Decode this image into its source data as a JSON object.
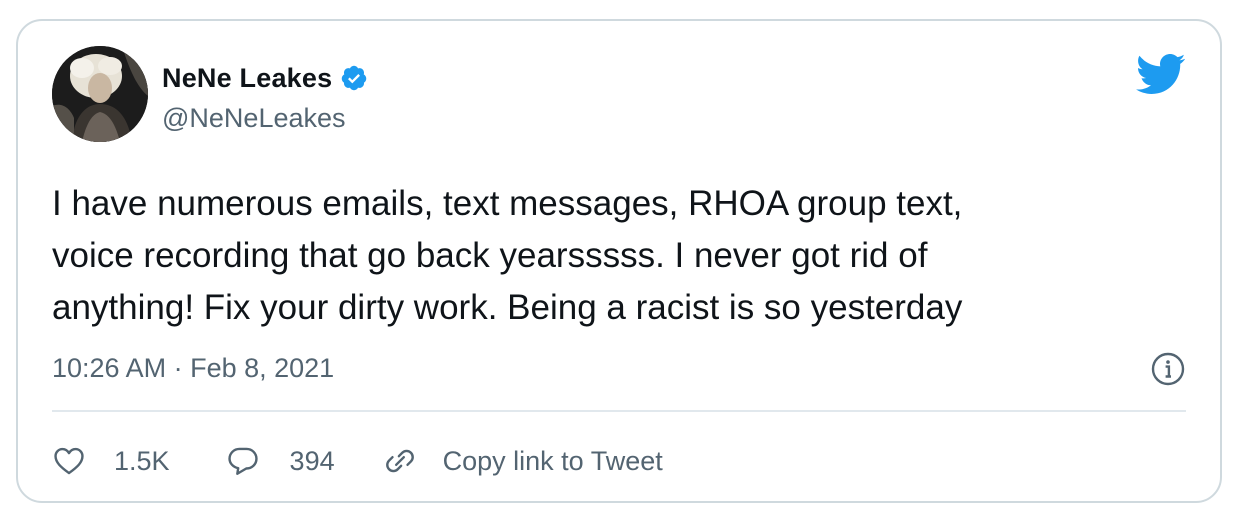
{
  "tweet": {
    "author": {
      "display_name": "NeNe Leakes",
      "handle": "@NeNeLeakes",
      "verified": true,
      "avatar": "profile-photo"
    },
    "text": "I have numerous emails, text messages, RHOA group text,\nvoice recording that go back yearsssss. I never got rid of\nanything! Fix your dirty work. Being a racist is so yesterday",
    "timestamp": "10:26 AM · Feb 8, 2021",
    "actions": {
      "likes": "1.5K",
      "replies": "394",
      "copy_link": "Copy link to Tweet"
    },
    "icons": {
      "brand": "twitter-bird-icon",
      "verified": "verified-badge-icon",
      "info": "info-icon",
      "like": "heart-icon",
      "reply": "reply-bubble-icon",
      "link": "link-icon"
    },
    "colors": {
      "brand": "#1d9bf0",
      "text": "#0f1419",
      "secondary": "#536471",
      "border": "#cfd9de"
    }
  }
}
